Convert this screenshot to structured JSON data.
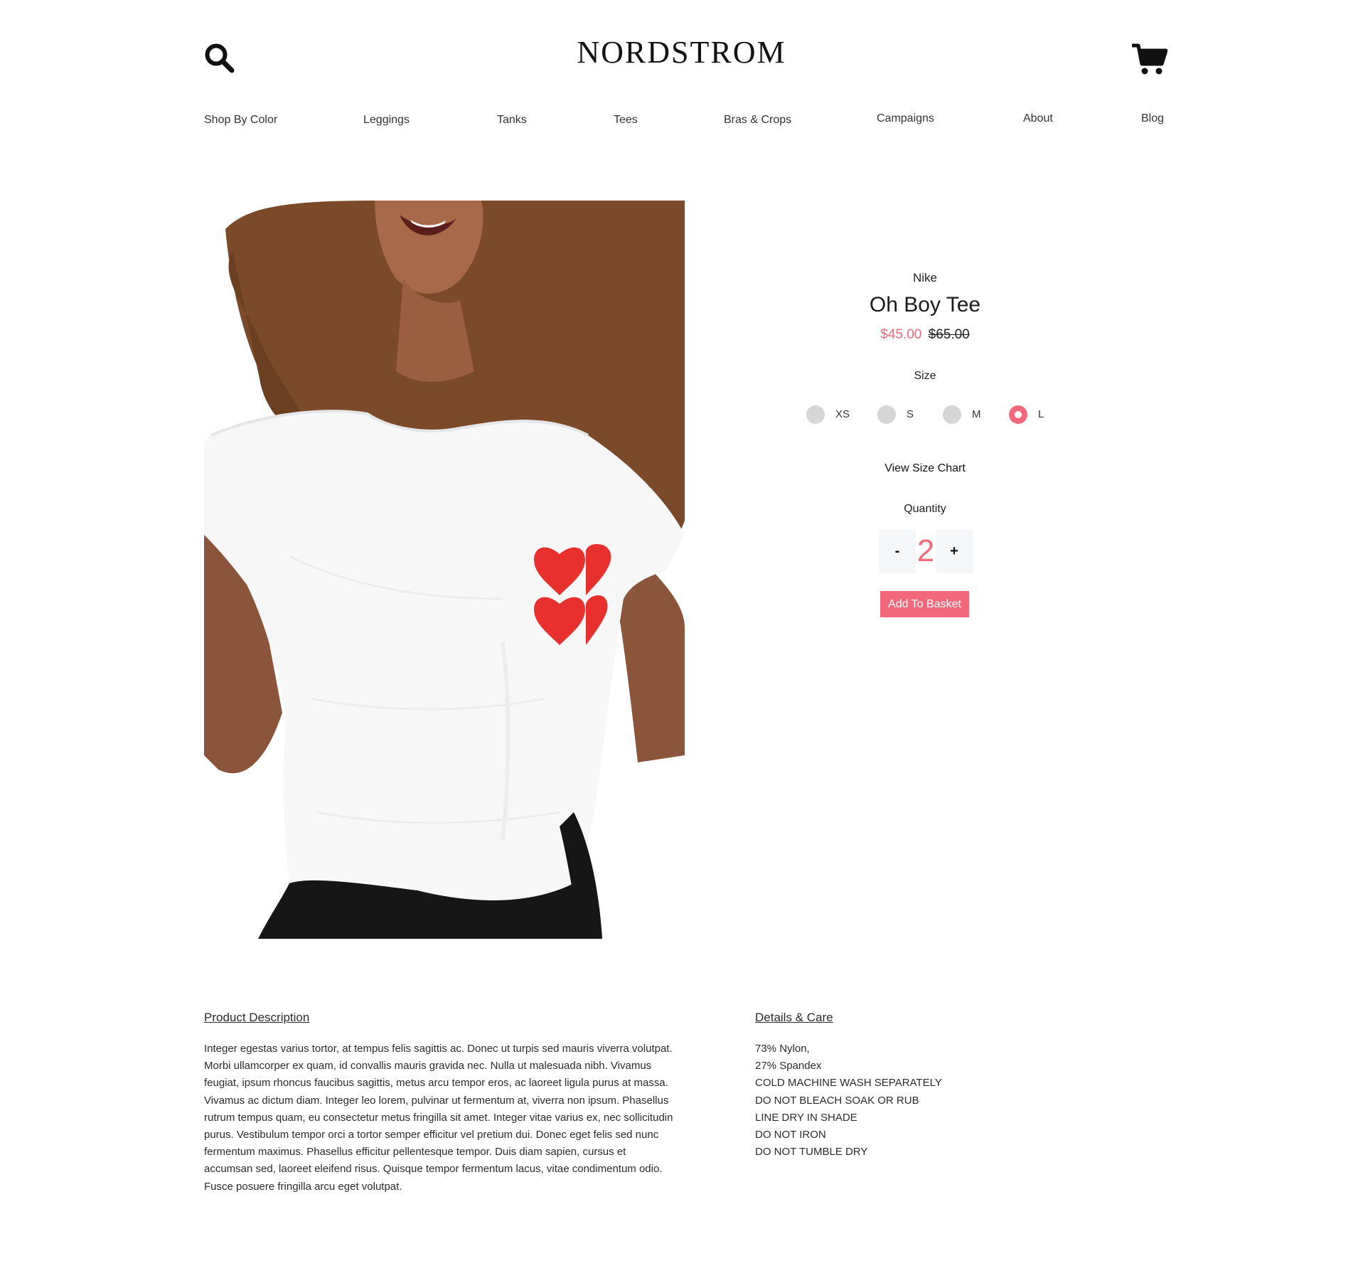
{
  "header": {
    "brand": "NORDSTROM",
    "search_icon": "search-icon",
    "cart_icon": "shopping-cart-icon"
  },
  "nav": {
    "items": [
      {
        "label": "Shop By Color"
      },
      {
        "label": "Leggings"
      },
      {
        "label": "Tanks"
      },
      {
        "label": "Tees"
      },
      {
        "label": "Bras & Crops"
      },
      {
        "label": "Campaigns"
      },
      {
        "label": "About"
      },
      {
        "label": "Blog"
      }
    ]
  },
  "product": {
    "brand": "Nike",
    "title": "Oh Boy Tee",
    "sale_price": "$45.00",
    "original_price": "$65.00",
    "size_label": "Size",
    "sizes": [
      "XS",
      "S",
      "M",
      "L"
    ],
    "selected_size": "L",
    "size_chart_link": "View Size Chart",
    "quantity_label": "Quantity",
    "quantity": "2",
    "qty_minus": "-",
    "qty_plus": "+",
    "add_to_basket": "Add To Basket"
  },
  "description": {
    "title": "Product Description",
    "body": "Integer egestas varius tortor, at tempus felis sagittis ac. Donec ut turpis sed mauris viverra volutpat. Morbi ullamcorper ex quam, id convallis mauris gravida nec. Nulla ut malesuada nibh. Vivamus feugiat, ipsum rhoncus faucibus sagittis, metus arcu tempor eros, ac laoreet ligula purus at massa. Vivamus ac dictum diam. Integer leo lorem, pulvinar ut fermentum at, viverra non ipsum. Phasellus rutrum tempus quam, eu consectetur metus fringilla sit amet. Integer vitae varius ex, nec sollicitudin purus. Vestibulum tempor orci a tortor semper efficitur vel pretium dui. Donec eget felis sed nunc fermentum maximus. Phasellus efficitur pellentesque tempor. Duis diam sapien, cursus et accumsan sed, laoreet eleifend risus. Quisque tempor fermentum lacus, vitae condimentum odio. Fusce posuere fringilla arcu eget volutpat."
  },
  "details": {
    "title": "Details & Care",
    "lines": [
      "73% Nylon,",
      "27% Spandex",
      "COLD MACHINE WASH SEPARATELY",
      "DO NOT BLEACH SOAK OR RUB",
      "LINE DRY IN SHADE",
      "DO NOT IRON",
      "DO NOT TUMBLE DRY"
    ]
  },
  "colors": {
    "accent": "#f2687a",
    "size_unselected": "#d6d6d6",
    "qty_button_bg": "#f5f6f8"
  }
}
